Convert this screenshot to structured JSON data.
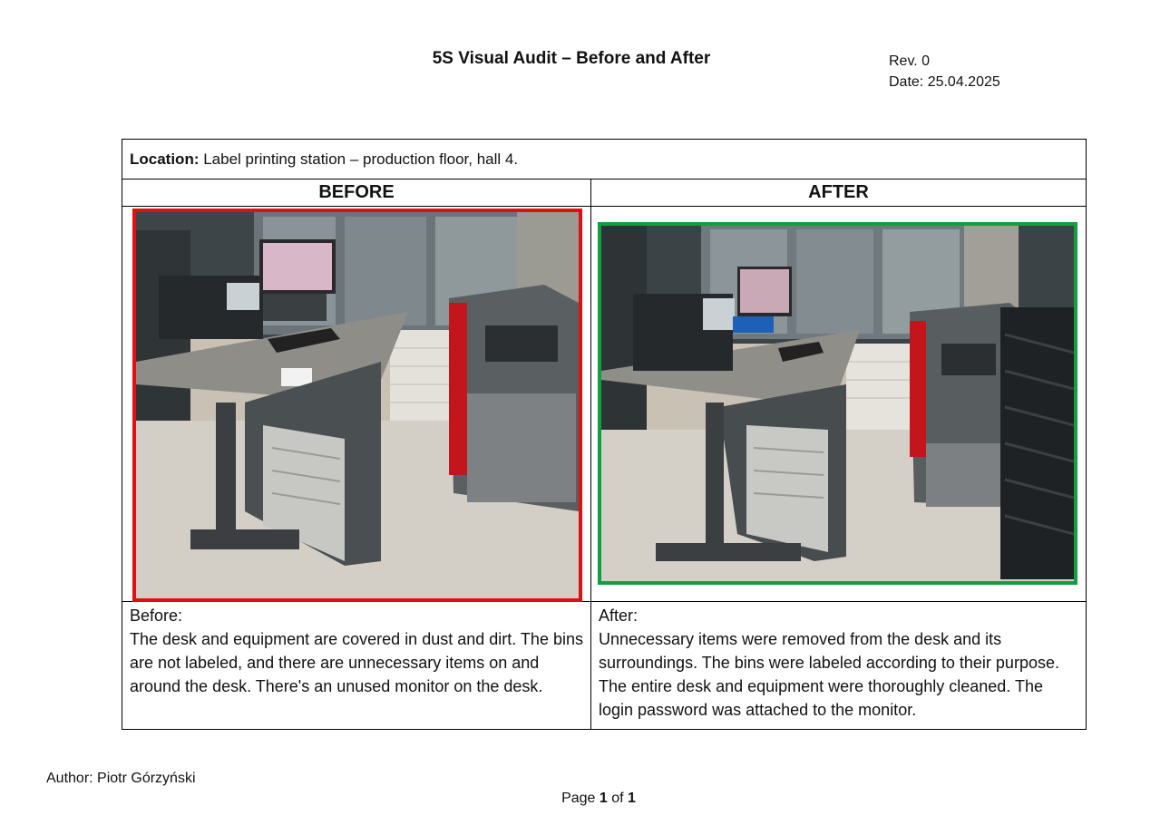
{
  "document": {
    "title": "5S Visual Audit – Before and After",
    "revision": "Rev. 0",
    "date": "Date: 25.04.2025"
  },
  "table": {
    "location_label": "Location:",
    "location_value": " Label printing station – production floor, hall 4.",
    "before_header": "BEFORE",
    "after_header": "AFTER",
    "before_photo_border_color": "#e01010",
    "after_photo_border_color": "#10a040",
    "before_desc_title": "Before:",
    "before_desc_text": "The desk and equipment are covered in dust and dirt. The bins are not labeled, and there are unnecessary items on and around the desk. There's an unused monitor on the desk.",
    "after_desc_title": "After:",
    "after_desc_text": "Unnecessary items were removed from the desk and its surroundings. The bins were labeled according to their purpose. The entire desk and equipment were thoroughly cleaned. The login password was attached to the monitor."
  },
  "footer": {
    "author": "Author: Piotr Górzyński",
    "page_prefix": "Page ",
    "page_current": "1",
    "page_mid": " of ",
    "page_total": "1"
  }
}
